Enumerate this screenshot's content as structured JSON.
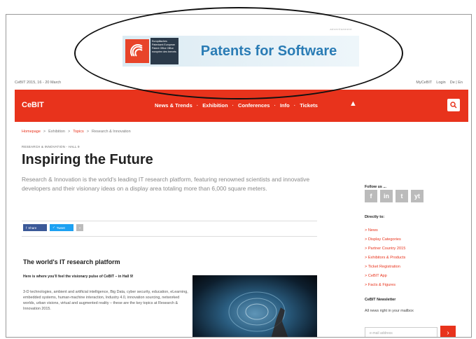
{
  "ad": {
    "small_label": "advertisement",
    "org_text": "Europäisches Patentamt European Patent Office Office européen des brevets",
    "title": "Patents for Software"
  },
  "topline": {
    "date": "CeBIT 2015, 16 - 20 March",
    "my_cebit": "MyCeBIT",
    "login": "Login",
    "lang": "De | En"
  },
  "nav": {
    "logo": "CeBIT",
    "items": [
      "News & Trends",
      "Exhibition",
      "Conferences",
      "Info",
      "Tickets"
    ]
  },
  "breadcrumb": {
    "items": [
      "Homepage",
      "Exhibition",
      "Topics",
      "Research & Innovation"
    ]
  },
  "page": {
    "kicker": "RESEARCH & INNOVATION - HALL 9",
    "title": "Inspiring the Future",
    "lead": "Research & Innovation is the world's leading IT research platform, featuring renowned scientists and innovative developers and their visionary ideas on a display area totaling more than 6,000 square meters.",
    "share": {
      "facebook": "Share",
      "twitter": "Tweet",
      "more": "+"
    },
    "section_heading": "The world's IT research platform",
    "subheading": "Here is where you'll feel the visionary pulse of CeBIT – in Hall 9!",
    "body": "3-D technologies, ambient and artificial intelligence, Big Data, cyber security, education, eLearning, embedded systems, human-machine interaction, Industry 4.0, innovation sourcing, networked worlds, urban visions, virtual and augmented reality – these are the key topics at Research & Innovation 2015."
  },
  "sidebar": {
    "follow_label": "Follow us ...",
    "social": [
      "f",
      "in",
      "t",
      "yt"
    ],
    "directly_label": "Directly to:",
    "links": [
      "> News",
      "> Display Categories",
      "> Partner Country 2015",
      "> Exhibitors & Products",
      "> Ticket Registration",
      "> CeBIT App",
      "> Facts & Figures"
    ],
    "newsletter_label": "CeBIT Newsletter",
    "newsletter_sub": "All news right in your mailbox",
    "email_placeholder": "e-mail address"
  },
  "colors": {
    "brand": "#e8331c",
    "ad_blue": "#2a7cb5"
  }
}
